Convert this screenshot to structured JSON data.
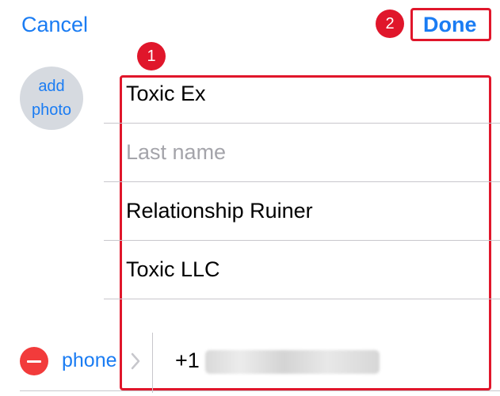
{
  "nav": {
    "cancel_label": "Cancel",
    "done_label": "Done"
  },
  "callouts": {
    "fields_number": "1",
    "done_number": "2"
  },
  "photo": {
    "line1": "add",
    "line2": "photo"
  },
  "fields": {
    "first_name": "Toxic Ex",
    "last_name_placeholder": "Last name",
    "job_title": "Relationship Ruiner",
    "company": "Toxic LLC"
  },
  "phone": {
    "label": "phone",
    "value_prefix": "+1"
  },
  "colors": {
    "accent": "#1a7cf3",
    "callout": "#e0162b",
    "delete": "#f23b3b",
    "placeholder": "#a4a4aa"
  },
  "icons": {
    "remove": "minus-circle-icon",
    "chevron": "chevron-right-icon"
  }
}
